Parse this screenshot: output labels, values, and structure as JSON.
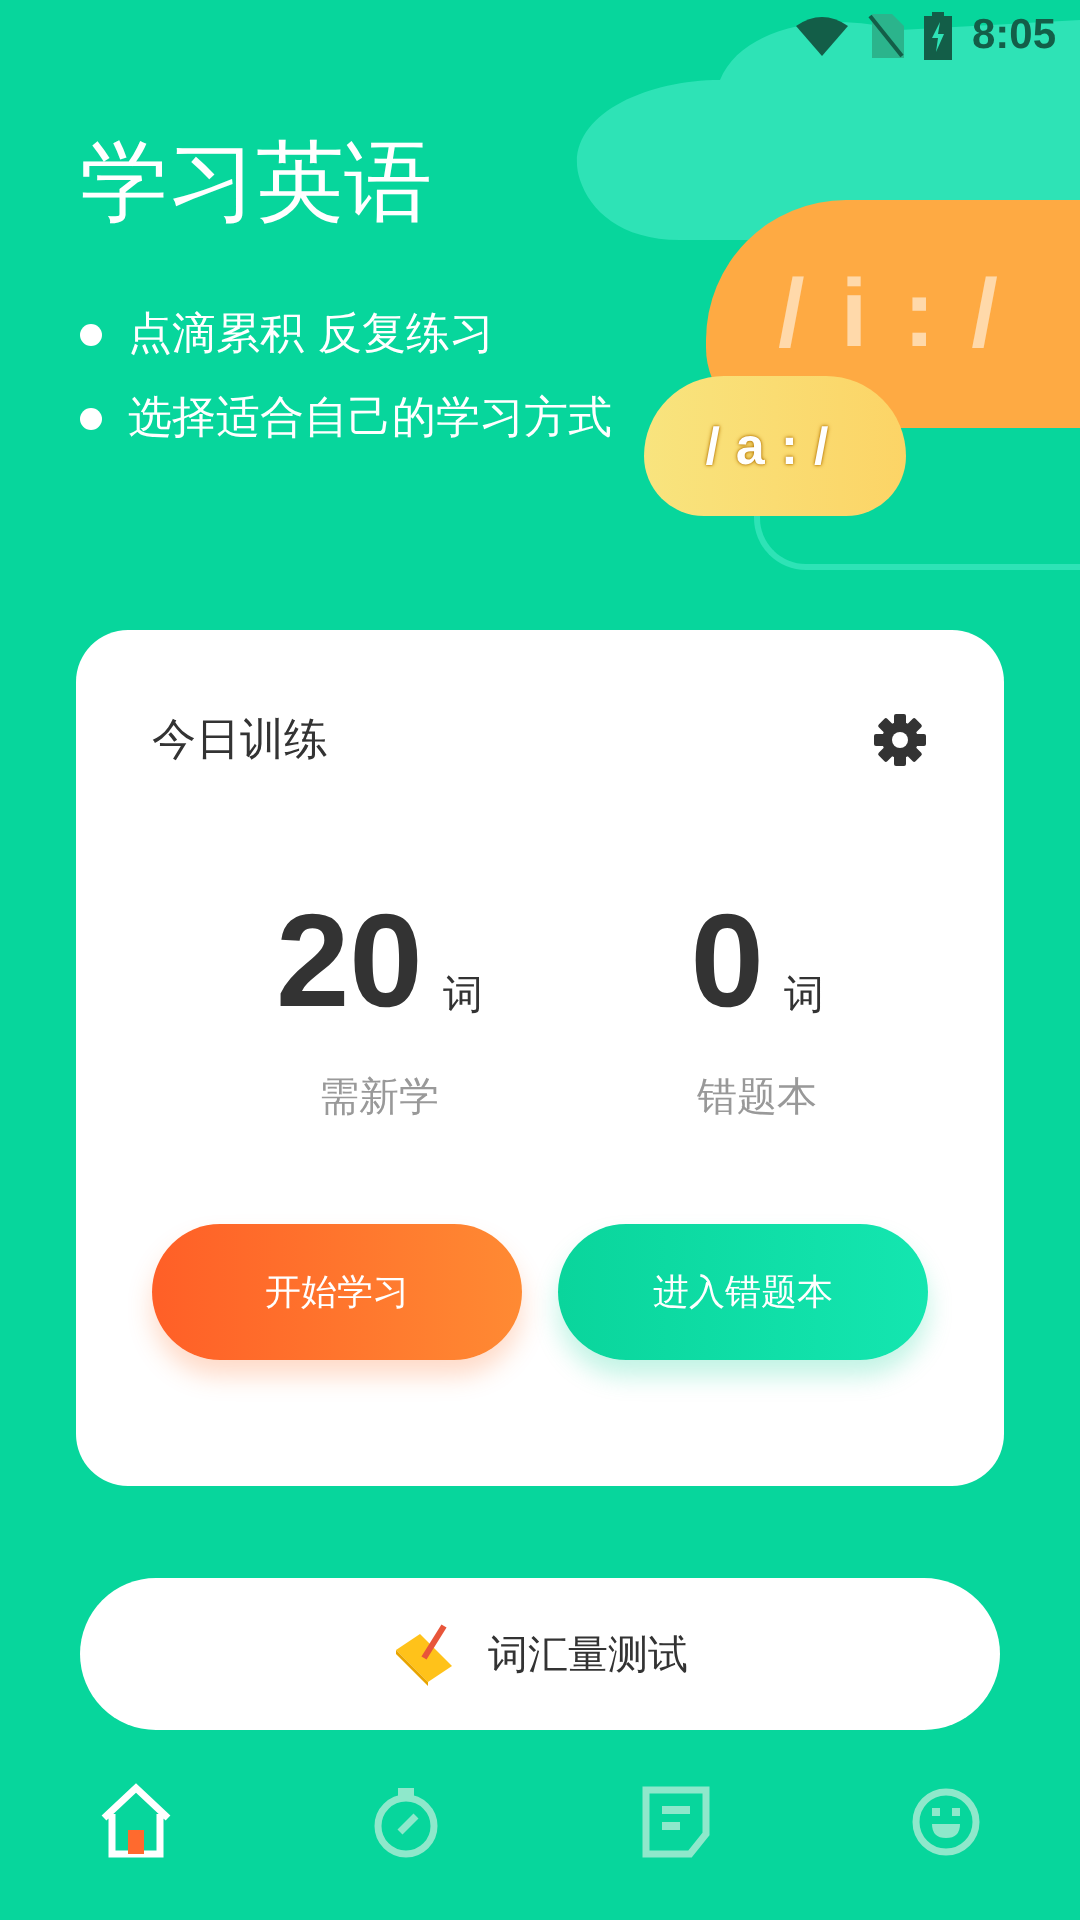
{
  "status_bar": {
    "time": "8:05"
  },
  "header": {
    "title": "学习英语",
    "bullets": [
      "点滴累积 反复练习",
      "选择适合自己的学习方式"
    ],
    "clouds": [
      "/i:/",
      "/a:/"
    ]
  },
  "card": {
    "title": "今日训练",
    "stats": [
      {
        "value": "20",
        "unit": "词",
        "label": "需新学"
      },
      {
        "value": "0",
        "unit": "词",
        "label": "错题本"
      }
    ],
    "buttons": [
      {
        "label": "开始学习",
        "kind": "orange"
      },
      {
        "label": "进入错题本",
        "kind": "green"
      }
    ]
  },
  "vocab_test": {
    "label": "词汇量测试"
  },
  "nav": [
    {
      "kind": "home",
      "selected": true
    },
    {
      "kind": "timer",
      "selected": false
    },
    {
      "kind": "note",
      "selected": false
    },
    {
      "kind": "smile",
      "selected": false
    }
  ]
}
